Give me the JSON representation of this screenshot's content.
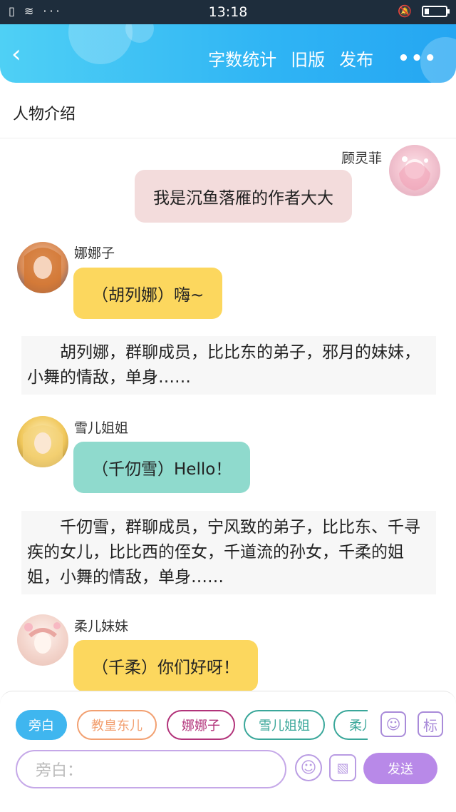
{
  "status_bar": {
    "time": "13:18",
    "left_icons": "▯ ≋ ···",
    "right_icons": "🔕"
  },
  "header": {
    "back_icon": "‹",
    "word_count_label": "字数统计",
    "old_version_label": "旧版",
    "publish_label": "发布",
    "more_icon": "•••"
  },
  "intro": {
    "label": "人物介绍"
  },
  "messages": [
    {
      "name": "顾灵菲",
      "text": "我是沉鱼落雁的作者大大",
      "bubble_color": "#f3dcdc"
    },
    {
      "name": "娜娜子",
      "text": "（胡列娜）嗨~",
      "bubble_color": "#fcd75e"
    },
    {
      "name": "雪儿姐姐",
      "text": "（千仞雪）Hello！",
      "bubble_color": "#8fdacd"
    },
    {
      "name": "柔儿妹妹",
      "text": "（千柔）你们好呀！",
      "bubble_color": "#fcd75e"
    }
  ],
  "descriptions": [
    "胡列娜，群聊成员，比比东的弟子，邪月的妹妹，小舞的情敌，单身……",
    "千仞雪，群聊成员，宁风致的弟子，比比东、千寻疾的女儿，比比西的侄女，千道流的孙女，千柔的姐姐，小舞的情敌，单身……"
  ],
  "roles": [
    {
      "label": "旁白",
      "color": "#3fb6ef",
      "active": true
    },
    {
      "label": "教皇东儿",
      "color": "#f2a071",
      "active": false
    },
    {
      "label": "娜娜子",
      "color": "#b2337a",
      "active": false
    },
    {
      "label": "雪儿姐姐",
      "color": "#3aa79a",
      "active": false
    },
    {
      "label": "柔儿",
      "color": "#3aa79a",
      "active": false
    }
  ],
  "tools": {
    "role_icon": "☺",
    "tag_label": "标",
    "emoji_icon": "☺",
    "image_icon": "▧"
  },
  "input": {
    "placeholder": "旁白："
  },
  "send": {
    "label": "发送"
  },
  "colors": {
    "header_start": "#4fd0f5",
    "header_end": "#25a6f2",
    "accent_purple": "#b889e8"
  }
}
